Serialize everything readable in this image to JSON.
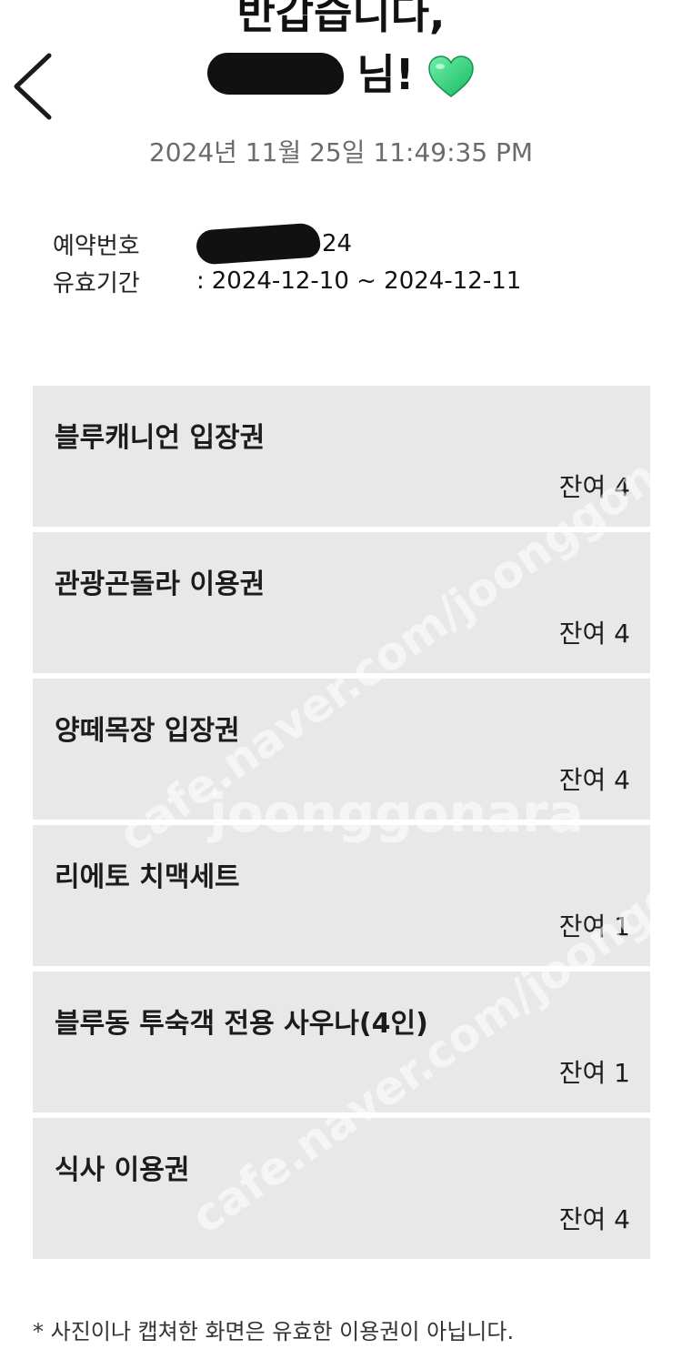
{
  "header": {
    "back_icon": "chevron-left-icon",
    "greeting_line1": "반갑습니다,",
    "greeting_suffix": "님!",
    "heart_icon": "green-heart-icon",
    "heart_color": "#2ed47a"
  },
  "timestamp": "2024년 11월 25일 11:49:35 PM",
  "reservation": {
    "number_label": "예약번호",
    "number_value_suffix": "24",
    "validity_label": "유효기간",
    "validity_value": "2024-12-10 ~ 2024-12-11",
    "separator": ":"
  },
  "tickets": [
    {
      "name": "블루캐니언 입장권",
      "remaining": "잔여 4"
    },
    {
      "name": "관광곤돌라 이용권",
      "remaining": "잔여 4"
    },
    {
      "name": "양떼목장 입장권",
      "remaining": "잔여 4"
    },
    {
      "name": "리에토 치맥세트",
      "remaining": "잔여 1"
    },
    {
      "name": "블루동 투숙객 전용 사우나(4인)",
      "remaining": "잔여 1"
    },
    {
      "name": "식사 이용권",
      "remaining": "잔여 4"
    }
  ],
  "notice": "* 사진이나 캡쳐한 화면은 유효한 이용권이 아닙니다.",
  "watermark": {
    "lines": [
      "cafe.naver.com/joonggonara",
      "joonggonara",
      "cafe.naver.com/joonggonara"
    ]
  },
  "colors": {
    "card_background": "#e8e8e8",
    "timestamp_text": "#6b6b6b"
  }
}
